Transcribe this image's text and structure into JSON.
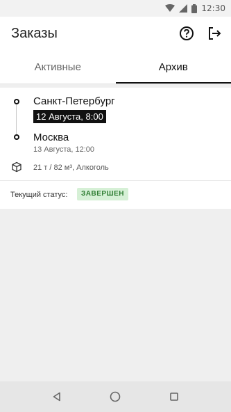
{
  "status_bar": {
    "time": "12:30"
  },
  "app_bar": {
    "title": "Заказы"
  },
  "tabs": [
    {
      "label": "Активные",
      "active": false
    },
    {
      "label": "Архив",
      "active": true
    }
  ],
  "order": {
    "origin": {
      "city": "Санкт-Петербург",
      "date": "12 Августа, 8:00"
    },
    "destination": {
      "city": "Москва",
      "date": "13 Августа, 12:00"
    },
    "cargo": "21 т / 82 м³, Алкоголь",
    "status_label": "Текущий статус:",
    "status_value": "ЗАВЕРШЕН"
  },
  "colors": {
    "status_badge_bg": "#d6f0d6",
    "status_badge_text": "#2e7d32"
  }
}
